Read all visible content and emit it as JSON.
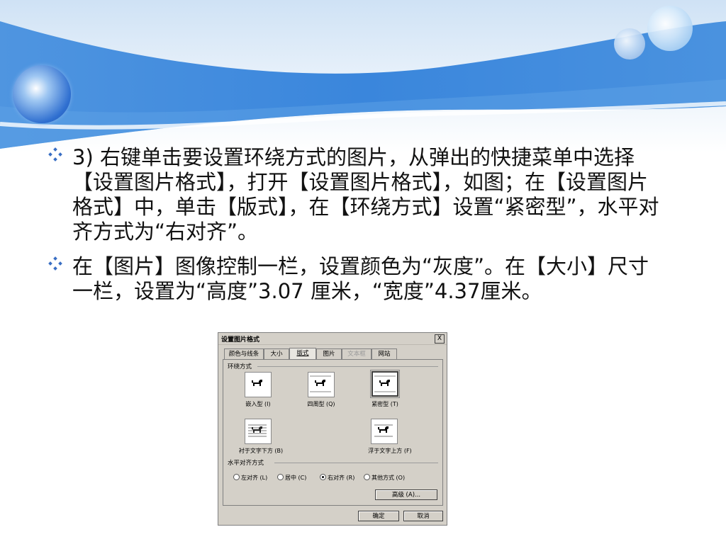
{
  "bullets": [
    {
      "text": "3) 右键单击要设置环绕方式的图片，从弹出的快捷菜单中选择【设置图片格式】，打开【设置图片格式】，如图；在【设置图片格式】中，单击【版式】，在【环绕方式】设置“紧密型”，水平对齐方式为“右对齐”。"
    },
    {
      "text": "在【图片】图像控制一栏，设置颜色为“灰度”。在【大小】尺寸一栏，设置为“高度”3.07 厘米，“宽度”4.37厘米。"
    }
  ],
  "dialog": {
    "title": "设置图片格式",
    "close": "X",
    "tabs": [
      "颜色与线条",
      "大小",
      "版式",
      "图片",
      "文本框",
      "网站"
    ],
    "active_tab": "版式",
    "wrap_group_label": "环绕方式",
    "wrap_options": [
      "嵌入型 (I)",
      "四周型 (Q)",
      "紧密型 (T)",
      "衬于文字下方 (B)",
      "浮于文字上方 (F)"
    ],
    "selected_wrap": "紧密型 (T)",
    "halign_group_label": "水平对齐方式",
    "halign_options": [
      "左对齐 (L)",
      "居中 (C)",
      "右对齐 (R)",
      "其他方式 (O)"
    ],
    "selected_halign": "右对齐 (R)",
    "advanced_button": "高级 (A)...",
    "ok_button": "确定",
    "cancel_button": "取消"
  },
  "colors": {
    "accent_blue": "#2f7fd6",
    "bullet_blue": "#3a6fc4",
    "dialog_bg": "#d4d0c8"
  }
}
